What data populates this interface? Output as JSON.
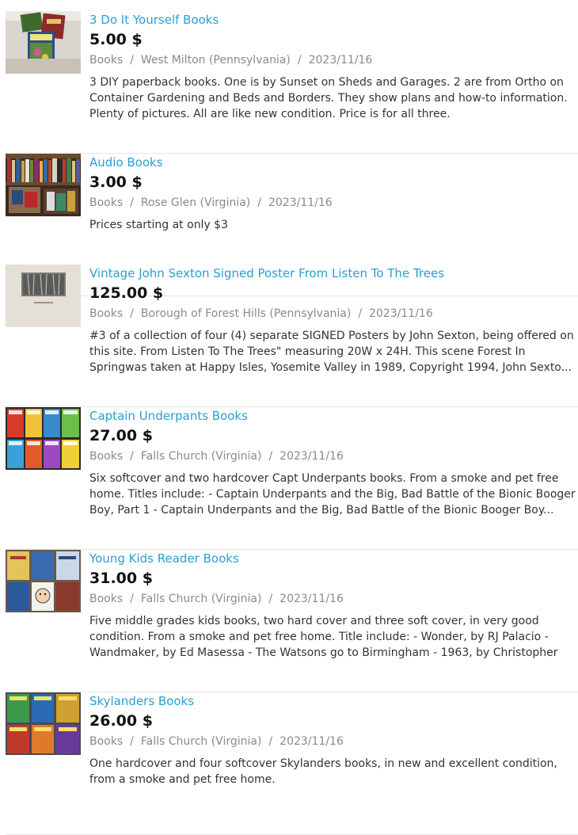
{
  "currency_suffix": "$",
  "listings": [
    {
      "title": "3 Do It Yourself Books",
      "price": "5.00 $",
      "category": "Books",
      "location": "West Milton (Pennsylvania)",
      "date": "2023/11/16",
      "description": "3 DIY paperback books. One is by Sunset on Sheds and Garages. 2 are from Ortho on Container Gardening and Beds and Borders. They show plans and how-to information. Plenty of pictures. All are like new condition. Price is for all three.",
      "image": "diy-books-photo"
    },
    {
      "title": "Audio Books",
      "price": "3.00 $",
      "category": "Books",
      "location": "Rose Glen (Virginia)",
      "date": "2023/11/16",
      "description": "Prices starting at only $3",
      "image": "audio-books-shelf-photo"
    },
    {
      "title": "Vintage John Sexton Signed Poster From Listen To The Trees",
      "price": "125.00 $",
      "category": "Books",
      "location": "Borough of Forest Hills (Pennsylvania)",
      "date": "2023/11/16",
      "description": "#3 of a collection of four (4) separate SIGNED Posters by John Sexton, being offered on this site. From Listen To The Trees\" measuring 20W x 24H. This scene Forest In Springwas taken at Happy Isles, Yosemite Valley in 1989, Copyright 1994, John Sexto...",
      "image": "poster-photo"
    },
    {
      "title": "Captain Underpants Books",
      "price": "27.00 $",
      "category": "Books",
      "location": "Falls Church (Virginia)",
      "date": "2023/11/16",
      "description": "Six softcover and two hardcover Capt Underpants books. From a smoke and pet free home. Titles include: - Captain Underpants and the Big, Bad Battle of the Bionic Booger Boy, Part 1 - Captain Underpants and the Big, Bad Battle of the Bionic Booger Boy...",
      "image": "captain-underpants-books-photo"
    },
    {
      "title": "Young Kids Reader Books",
      "price": "31.00 $",
      "category": "Books",
      "location": "Falls Church (Virginia)",
      "date": "2023/11/16",
      "description": "Five middle grades kids books, two hard cover and three soft cover, in very good condition. From a smoke and pet free home. Title include: - Wonder, by RJ Palacio - Wandmaker, by Ed Masessa - The Watsons go to Birmingham - 1963, by Christopher Paul C...",
      "image": "kids-reader-books-photo"
    },
    {
      "title": "Skylanders Books",
      "price": "26.00 $",
      "category": "Books",
      "location": "Falls Church (Virginia)",
      "date": "2023/11/16",
      "description": "One hardcover and four softcover Skylanders books, in new and excellent condition, from a smoke and pet free home.",
      "image": "skylanders-books-photo"
    }
  ],
  "colors": {
    "link": "#2a9fd0",
    "meta": "#8a8a8a",
    "price": "#111111",
    "divider": "#e6e6e6"
  }
}
